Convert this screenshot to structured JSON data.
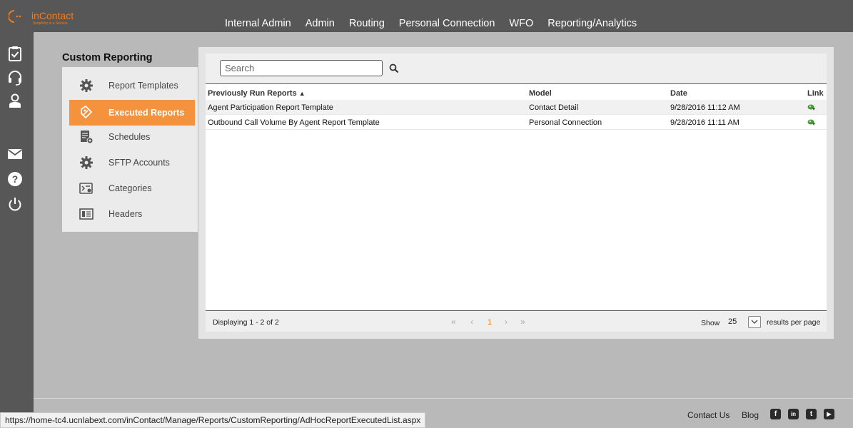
{
  "logo": {
    "brand": "inContact",
    "tagline": "Simplicity in a Service"
  },
  "nav": [
    "Internal Admin",
    "Admin",
    "Routing",
    "Personal Connection",
    "WFO",
    "Reporting/Analytics"
  ],
  "rail_icons": [
    "clipboard-check-icon",
    "headset-icon",
    "agent-icon",
    "mail-icon",
    "help-icon",
    "power-icon"
  ],
  "sidebar": {
    "title": "Custom Reporting",
    "items": [
      {
        "label": "Report Templates",
        "icon": "gear-icon"
      },
      {
        "label": "Executed Reports",
        "icon": "executed-reports-icon",
        "active": true
      },
      {
        "label": "Schedules",
        "icon": "schedule-icon"
      },
      {
        "label": "SFTP Accounts",
        "icon": "gear-icon"
      },
      {
        "label": "Categories",
        "icon": "categories-icon"
      },
      {
        "label": "Headers",
        "icon": "headers-icon"
      }
    ]
  },
  "search": {
    "placeholder": "Search",
    "value": ""
  },
  "table": {
    "columns": [
      "Previously Run Reports",
      "Model",
      "Date",
      "Link"
    ],
    "sort_indicator": "▲",
    "rows": [
      {
        "report": "Agent Participation Report Template",
        "model": "Contact Detail",
        "date": "9/28/2016 11:12 AM"
      },
      {
        "report": "Outbound Call Volume By Agent Report Template",
        "model": "Personal Connection",
        "date": "9/28/2016 11:11 AM"
      }
    ]
  },
  "pager": {
    "displaying": "Displaying 1 - 2 of 2",
    "first": "«",
    "prev": "‹",
    "current_page": "1",
    "next": "›",
    "last": "»",
    "show_label": "Show",
    "per_page": "25",
    "per_page_suffix": "results per page"
  },
  "footer": {
    "contact": "Contact Us",
    "blog": "Blog",
    "social": [
      "f",
      "in",
      "t",
      "▶"
    ]
  },
  "statusbar": {
    "url": "https://home-tc4.ucnlabext.com/inContact/Manage/Reports/CustomReporting/AdHocReportExecutedList.aspx"
  },
  "colors": {
    "accent": "#f5923e",
    "chrome": "#575757",
    "background": "#b9b9b9",
    "link_icon": "#4a9a3a"
  }
}
